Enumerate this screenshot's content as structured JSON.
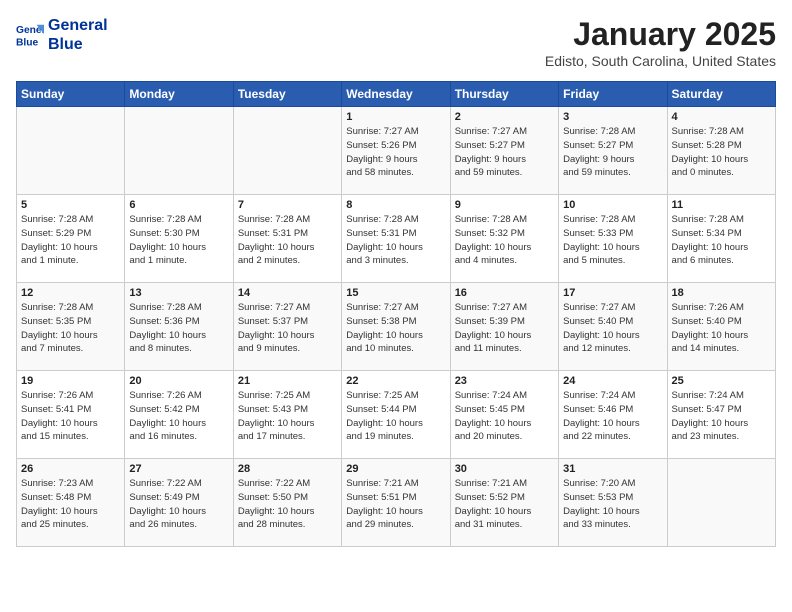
{
  "logo": {
    "line1": "General",
    "line2": "Blue"
  },
  "title": "January 2025",
  "subtitle": "Edisto, South Carolina, United States",
  "days_of_week": [
    "Sunday",
    "Monday",
    "Tuesday",
    "Wednesday",
    "Thursday",
    "Friday",
    "Saturday"
  ],
  "weeks": [
    [
      {
        "day": "",
        "info": ""
      },
      {
        "day": "",
        "info": ""
      },
      {
        "day": "",
        "info": ""
      },
      {
        "day": "1",
        "info": "Sunrise: 7:27 AM\nSunset: 5:26 PM\nDaylight: 9 hours\nand 58 minutes."
      },
      {
        "day": "2",
        "info": "Sunrise: 7:27 AM\nSunset: 5:27 PM\nDaylight: 9 hours\nand 59 minutes."
      },
      {
        "day": "3",
        "info": "Sunrise: 7:28 AM\nSunset: 5:27 PM\nDaylight: 9 hours\nand 59 minutes."
      },
      {
        "day": "4",
        "info": "Sunrise: 7:28 AM\nSunset: 5:28 PM\nDaylight: 10 hours\nand 0 minutes."
      }
    ],
    [
      {
        "day": "5",
        "info": "Sunrise: 7:28 AM\nSunset: 5:29 PM\nDaylight: 10 hours\nand 1 minute."
      },
      {
        "day": "6",
        "info": "Sunrise: 7:28 AM\nSunset: 5:30 PM\nDaylight: 10 hours\nand 1 minute."
      },
      {
        "day": "7",
        "info": "Sunrise: 7:28 AM\nSunset: 5:31 PM\nDaylight: 10 hours\nand 2 minutes."
      },
      {
        "day": "8",
        "info": "Sunrise: 7:28 AM\nSunset: 5:31 PM\nDaylight: 10 hours\nand 3 minutes."
      },
      {
        "day": "9",
        "info": "Sunrise: 7:28 AM\nSunset: 5:32 PM\nDaylight: 10 hours\nand 4 minutes."
      },
      {
        "day": "10",
        "info": "Sunrise: 7:28 AM\nSunset: 5:33 PM\nDaylight: 10 hours\nand 5 minutes."
      },
      {
        "day": "11",
        "info": "Sunrise: 7:28 AM\nSunset: 5:34 PM\nDaylight: 10 hours\nand 6 minutes."
      }
    ],
    [
      {
        "day": "12",
        "info": "Sunrise: 7:28 AM\nSunset: 5:35 PM\nDaylight: 10 hours\nand 7 minutes."
      },
      {
        "day": "13",
        "info": "Sunrise: 7:28 AM\nSunset: 5:36 PM\nDaylight: 10 hours\nand 8 minutes."
      },
      {
        "day": "14",
        "info": "Sunrise: 7:27 AM\nSunset: 5:37 PM\nDaylight: 10 hours\nand 9 minutes."
      },
      {
        "day": "15",
        "info": "Sunrise: 7:27 AM\nSunset: 5:38 PM\nDaylight: 10 hours\nand 10 minutes."
      },
      {
        "day": "16",
        "info": "Sunrise: 7:27 AM\nSunset: 5:39 PM\nDaylight: 10 hours\nand 11 minutes."
      },
      {
        "day": "17",
        "info": "Sunrise: 7:27 AM\nSunset: 5:40 PM\nDaylight: 10 hours\nand 12 minutes."
      },
      {
        "day": "18",
        "info": "Sunrise: 7:26 AM\nSunset: 5:40 PM\nDaylight: 10 hours\nand 14 minutes."
      }
    ],
    [
      {
        "day": "19",
        "info": "Sunrise: 7:26 AM\nSunset: 5:41 PM\nDaylight: 10 hours\nand 15 minutes."
      },
      {
        "day": "20",
        "info": "Sunrise: 7:26 AM\nSunset: 5:42 PM\nDaylight: 10 hours\nand 16 minutes."
      },
      {
        "day": "21",
        "info": "Sunrise: 7:25 AM\nSunset: 5:43 PM\nDaylight: 10 hours\nand 17 minutes."
      },
      {
        "day": "22",
        "info": "Sunrise: 7:25 AM\nSunset: 5:44 PM\nDaylight: 10 hours\nand 19 minutes."
      },
      {
        "day": "23",
        "info": "Sunrise: 7:24 AM\nSunset: 5:45 PM\nDaylight: 10 hours\nand 20 minutes."
      },
      {
        "day": "24",
        "info": "Sunrise: 7:24 AM\nSunset: 5:46 PM\nDaylight: 10 hours\nand 22 minutes."
      },
      {
        "day": "25",
        "info": "Sunrise: 7:24 AM\nSunset: 5:47 PM\nDaylight: 10 hours\nand 23 minutes."
      }
    ],
    [
      {
        "day": "26",
        "info": "Sunrise: 7:23 AM\nSunset: 5:48 PM\nDaylight: 10 hours\nand 25 minutes."
      },
      {
        "day": "27",
        "info": "Sunrise: 7:22 AM\nSunset: 5:49 PM\nDaylight: 10 hours\nand 26 minutes."
      },
      {
        "day": "28",
        "info": "Sunrise: 7:22 AM\nSunset: 5:50 PM\nDaylight: 10 hours\nand 28 minutes."
      },
      {
        "day": "29",
        "info": "Sunrise: 7:21 AM\nSunset: 5:51 PM\nDaylight: 10 hours\nand 29 minutes."
      },
      {
        "day": "30",
        "info": "Sunrise: 7:21 AM\nSunset: 5:52 PM\nDaylight: 10 hours\nand 31 minutes."
      },
      {
        "day": "31",
        "info": "Sunrise: 7:20 AM\nSunset: 5:53 PM\nDaylight: 10 hours\nand 33 minutes."
      },
      {
        "day": "",
        "info": ""
      }
    ]
  ]
}
